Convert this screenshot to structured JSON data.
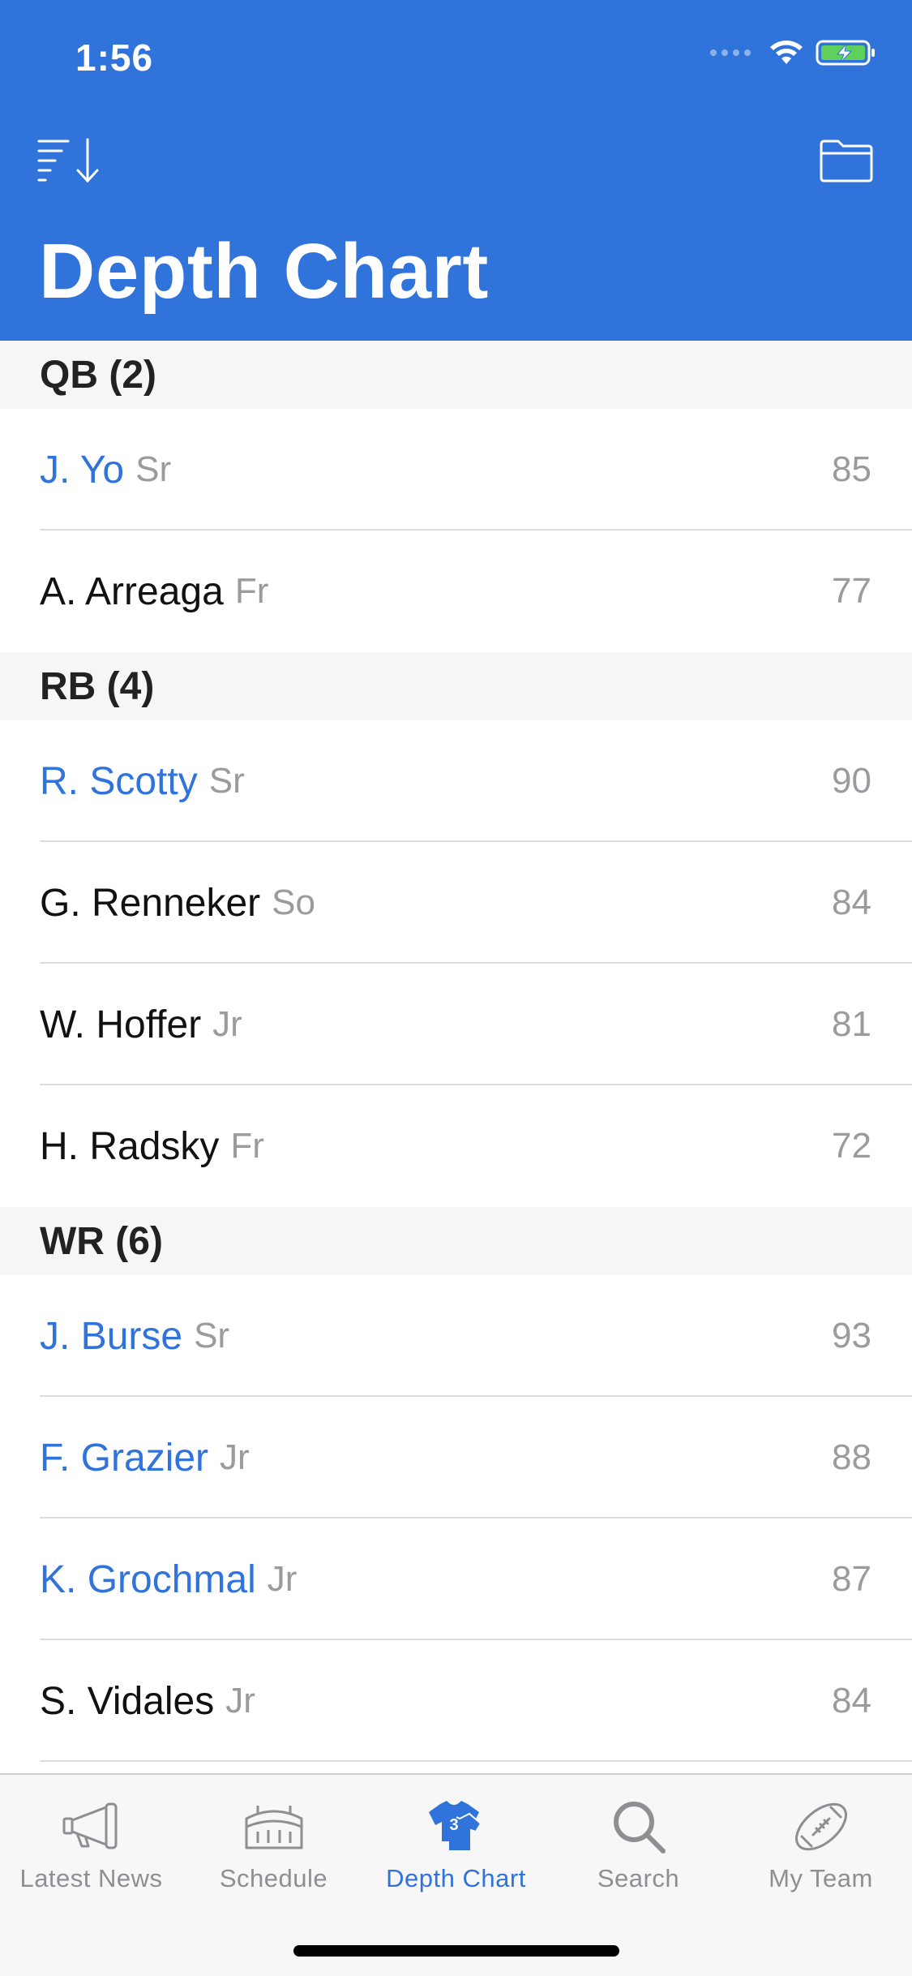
{
  "status_bar": {
    "time": "1:56"
  },
  "header": {
    "title": "Depth Chart",
    "sort_icon": "sort-descending-icon",
    "folder_icon": "folder-icon"
  },
  "colors": {
    "accent": "#2f73db",
    "section_background": "#f6f6f6",
    "secondary_text": "#9a9a9f"
  },
  "sections": [
    {
      "title": "QB (2)",
      "players": [
        {
          "name": "J. Yo",
          "class": "Sr",
          "rating": "85",
          "starter": true
        },
        {
          "name": "A. Arreaga",
          "class": "Fr",
          "rating": "77",
          "starter": false
        }
      ]
    },
    {
      "title": "RB (4)",
      "players": [
        {
          "name": "R. Scotty",
          "class": "Sr",
          "rating": "90",
          "starter": true
        },
        {
          "name": "G. Renneker",
          "class": "So",
          "rating": "84",
          "starter": false
        },
        {
          "name": "W. Hoffer",
          "class": "Jr",
          "rating": "81",
          "starter": false
        },
        {
          "name": "H. Radsky",
          "class": "Fr",
          "rating": "72",
          "starter": false
        }
      ]
    },
    {
      "title": "WR (6)",
      "players": [
        {
          "name": "J. Burse",
          "class": "Sr",
          "rating": "93",
          "starter": true
        },
        {
          "name": "F. Grazier",
          "class": "Jr",
          "rating": "88",
          "starter": true
        },
        {
          "name": "K. Grochmal",
          "class": "Jr",
          "rating": "87",
          "starter": true
        },
        {
          "name": "S. Vidales",
          "class": "Jr",
          "rating": "84",
          "starter": false
        }
      ]
    }
  ],
  "tabbar": {
    "tabs": [
      {
        "label": "Latest News",
        "icon": "megaphone-icon"
      },
      {
        "label": "Schedule",
        "icon": "stadium-icon"
      },
      {
        "label": "Depth Chart",
        "icon": "jersey-icon",
        "jersey_number": "3",
        "active": true
      },
      {
        "label": "Search",
        "icon": "search-icon"
      },
      {
        "label": "My Team",
        "icon": "football-icon"
      }
    ]
  }
}
